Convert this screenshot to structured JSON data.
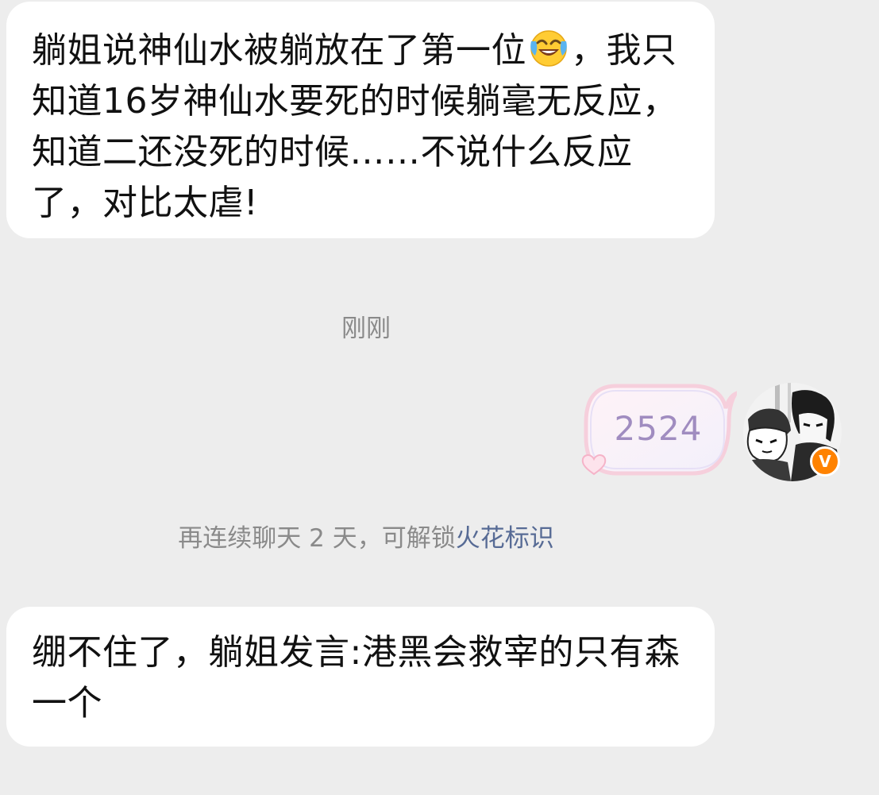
{
  "messages": [
    {
      "side": "left",
      "text_before_emoji": "躺姐说神仙水被躺放在了第一位",
      "emoji": "laughing-crying-emoji",
      "text_after_emoji": "，我只知道16岁神仙水要死的时候躺毫无反应，知道二还没死的时候……不说什么反应了，对比太虐!"
    },
    {
      "side": "right",
      "sticker_text": "2524"
    },
    {
      "side": "left",
      "text": "绷不住了，躺姐发言:港黑会救宰的只有森一个"
    }
  ],
  "timestamp": "刚刚",
  "system_tip": {
    "prefix": "再连续聊天 2 天，可解锁",
    "link": "火花标识"
  },
  "avatar": {
    "badge": "V",
    "badge_color": "#ff8200"
  },
  "colors": {
    "background": "#ededed",
    "bubble": "#ffffff",
    "link": "#576b95",
    "sticker_text": "#a08cc0"
  }
}
